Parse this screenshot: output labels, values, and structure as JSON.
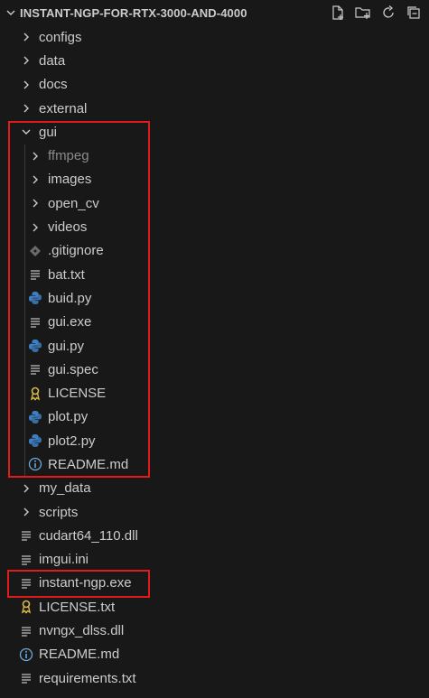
{
  "explorer": {
    "root_title": "INSTANT-NGP-FOR-RTX-3000-AND-4000",
    "actions": [
      {
        "name": "new-file-icon"
      },
      {
        "name": "new-folder-icon"
      },
      {
        "name": "refresh-icon"
      },
      {
        "name": "collapse-all-icon"
      }
    ],
    "items": [
      {
        "label": "configs",
        "type": "folder",
        "depth": 0,
        "expanded": false
      },
      {
        "label": "data",
        "type": "folder",
        "depth": 0,
        "expanded": false
      },
      {
        "label": "docs",
        "type": "folder",
        "depth": 0,
        "expanded": false
      },
      {
        "label": "external",
        "type": "folder",
        "depth": 0,
        "expanded": false
      },
      {
        "label": "gui",
        "type": "folder",
        "depth": 0,
        "expanded": true
      },
      {
        "label": "ffmpeg",
        "type": "folder",
        "depth": 1,
        "expanded": false,
        "dim": true
      },
      {
        "label": "images",
        "type": "folder",
        "depth": 1,
        "expanded": false
      },
      {
        "label": "open_cv",
        "type": "folder",
        "depth": 1,
        "expanded": false
      },
      {
        "label": "videos",
        "type": "folder",
        "depth": 1,
        "expanded": false
      },
      {
        "label": ".gitignore",
        "type": "git",
        "depth": 1
      },
      {
        "label": "bat.txt",
        "type": "text",
        "depth": 1
      },
      {
        "label": "buid.py",
        "type": "python",
        "depth": 1
      },
      {
        "label": "gui.exe",
        "type": "text",
        "depth": 1
      },
      {
        "label": "gui.py",
        "type": "python",
        "depth": 1
      },
      {
        "label": "gui.spec",
        "type": "text",
        "depth": 1
      },
      {
        "label": "LICENSE",
        "type": "license",
        "depth": 1
      },
      {
        "label": "plot.py",
        "type": "python",
        "depth": 1
      },
      {
        "label": "plot2.py",
        "type": "python",
        "depth": 1
      },
      {
        "label": "README.md",
        "type": "info",
        "depth": 1
      },
      {
        "label": "my_data",
        "type": "folder",
        "depth": 0,
        "expanded": false
      },
      {
        "label": "scripts",
        "type": "folder",
        "depth": 0,
        "expanded": false
      },
      {
        "label": "cudart64_110.dll",
        "type": "text",
        "depth": 0
      },
      {
        "label": "imgui.ini",
        "type": "text",
        "depth": 0
      },
      {
        "label": "instant-ngp.exe",
        "type": "text",
        "depth": 0
      },
      {
        "label": "LICENSE.txt",
        "type": "license",
        "depth": 0
      },
      {
        "label": "nvngx_dlss.dll",
        "type": "text",
        "depth": 0
      },
      {
        "label": "README.md",
        "type": "info",
        "depth": 0
      },
      {
        "label": "requirements.txt",
        "type": "text",
        "depth": 0
      }
    ]
  },
  "colors": {
    "background": "#181818",
    "text": "#cccccc",
    "python": "#3d7fc2",
    "license": "#d9b84a",
    "info": "#6fa8dc",
    "highlight": "#e01b1b"
  }
}
